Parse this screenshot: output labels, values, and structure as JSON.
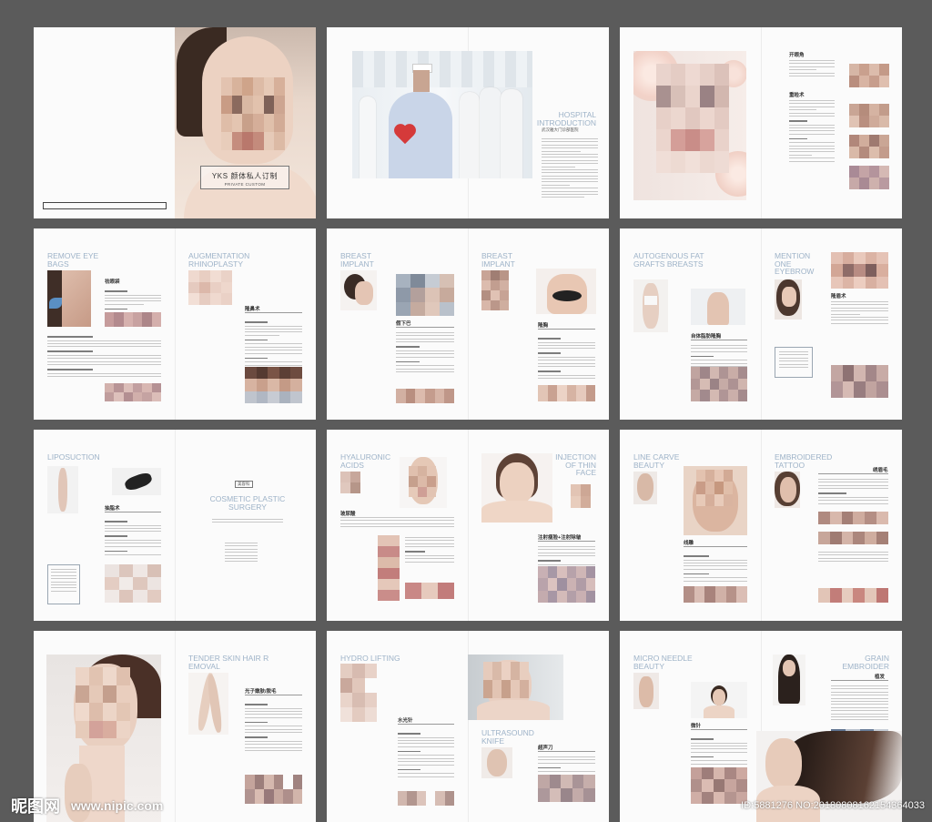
{
  "spreads": [
    {
      "titles": [],
      "cover": {
        "brand": "YKS 颜体私人订制",
        "subtitle": "PRIVATE CUSTOM"
      }
    },
    {
      "titles": [
        "HOSPITAL INTRODUCTION"
      ],
      "subtitle_zh": "武汉雅大门诊部医院"
    },
    {
      "titles": [],
      "zh_heads": [
        "开眼角",
        "重睑术"
      ]
    },
    {
      "titles": [
        "REMOVE EYE BAGS",
        "AUGMENTATION RHINOPLASTY"
      ],
      "zh_heads": [
        "祛眼袋",
        "隆鼻术"
      ]
    },
    {
      "titles": [
        "BREAST IMPLANT",
        "BREAST IMPLANT"
      ],
      "zh_heads": [
        "假下巴",
        "隆胸"
      ]
    },
    {
      "titles": [
        "AUTOGENOUS FAT GRAFTS BREASTS",
        "MENTION ONE EYEBROW"
      ],
      "zh_heads": [
        "自体脂肪隆胸",
        "隆眉术"
      ]
    },
    {
      "titles": [
        "LIPOSUCTION",
        "COSMETIC PLASTIC SURGERY"
      ],
      "zh_heads": [
        "抽脂术"
      ],
      "tag": "美容科"
    },
    {
      "titles": [
        "HYALURONIC ACIDS",
        "INJECTION OF THIN FACE"
      ],
      "zh_heads": [
        "玻尿酸",
        "注射瘦脸+注射除皱"
      ]
    },
    {
      "titles": [
        "LINE CARVE BEAUTY",
        "EMBROIDERED TATTOO"
      ],
      "zh_heads": [
        "线雕",
        "绣眉毛"
      ]
    },
    {
      "titles": [
        "TENDER SKIN HAIR R EMOVAL"
      ],
      "zh_heads": [
        "光子嫩肤/脱毛"
      ]
    },
    {
      "titles": [
        "HYDRO LIFTING",
        "ULTRASOUND KNIFE"
      ],
      "zh_heads": [
        "水光针",
        "超声刀"
      ]
    },
    {
      "titles": [
        "MICRO NEEDLE BEAUTY",
        "GRAIN EMBROIDER"
      ],
      "zh_heads": [
        "微针",
        "植发"
      ]
    }
  ],
  "watermark": {
    "logo": "昵图网",
    "url": "www.nipic.com",
    "id_line": "ID:5881276 NO:20180808162154364033"
  },
  "colors": {
    "background": "#5b5b5b",
    "title_blue": "#9eb3c8",
    "page": "#fbfbfb"
  }
}
